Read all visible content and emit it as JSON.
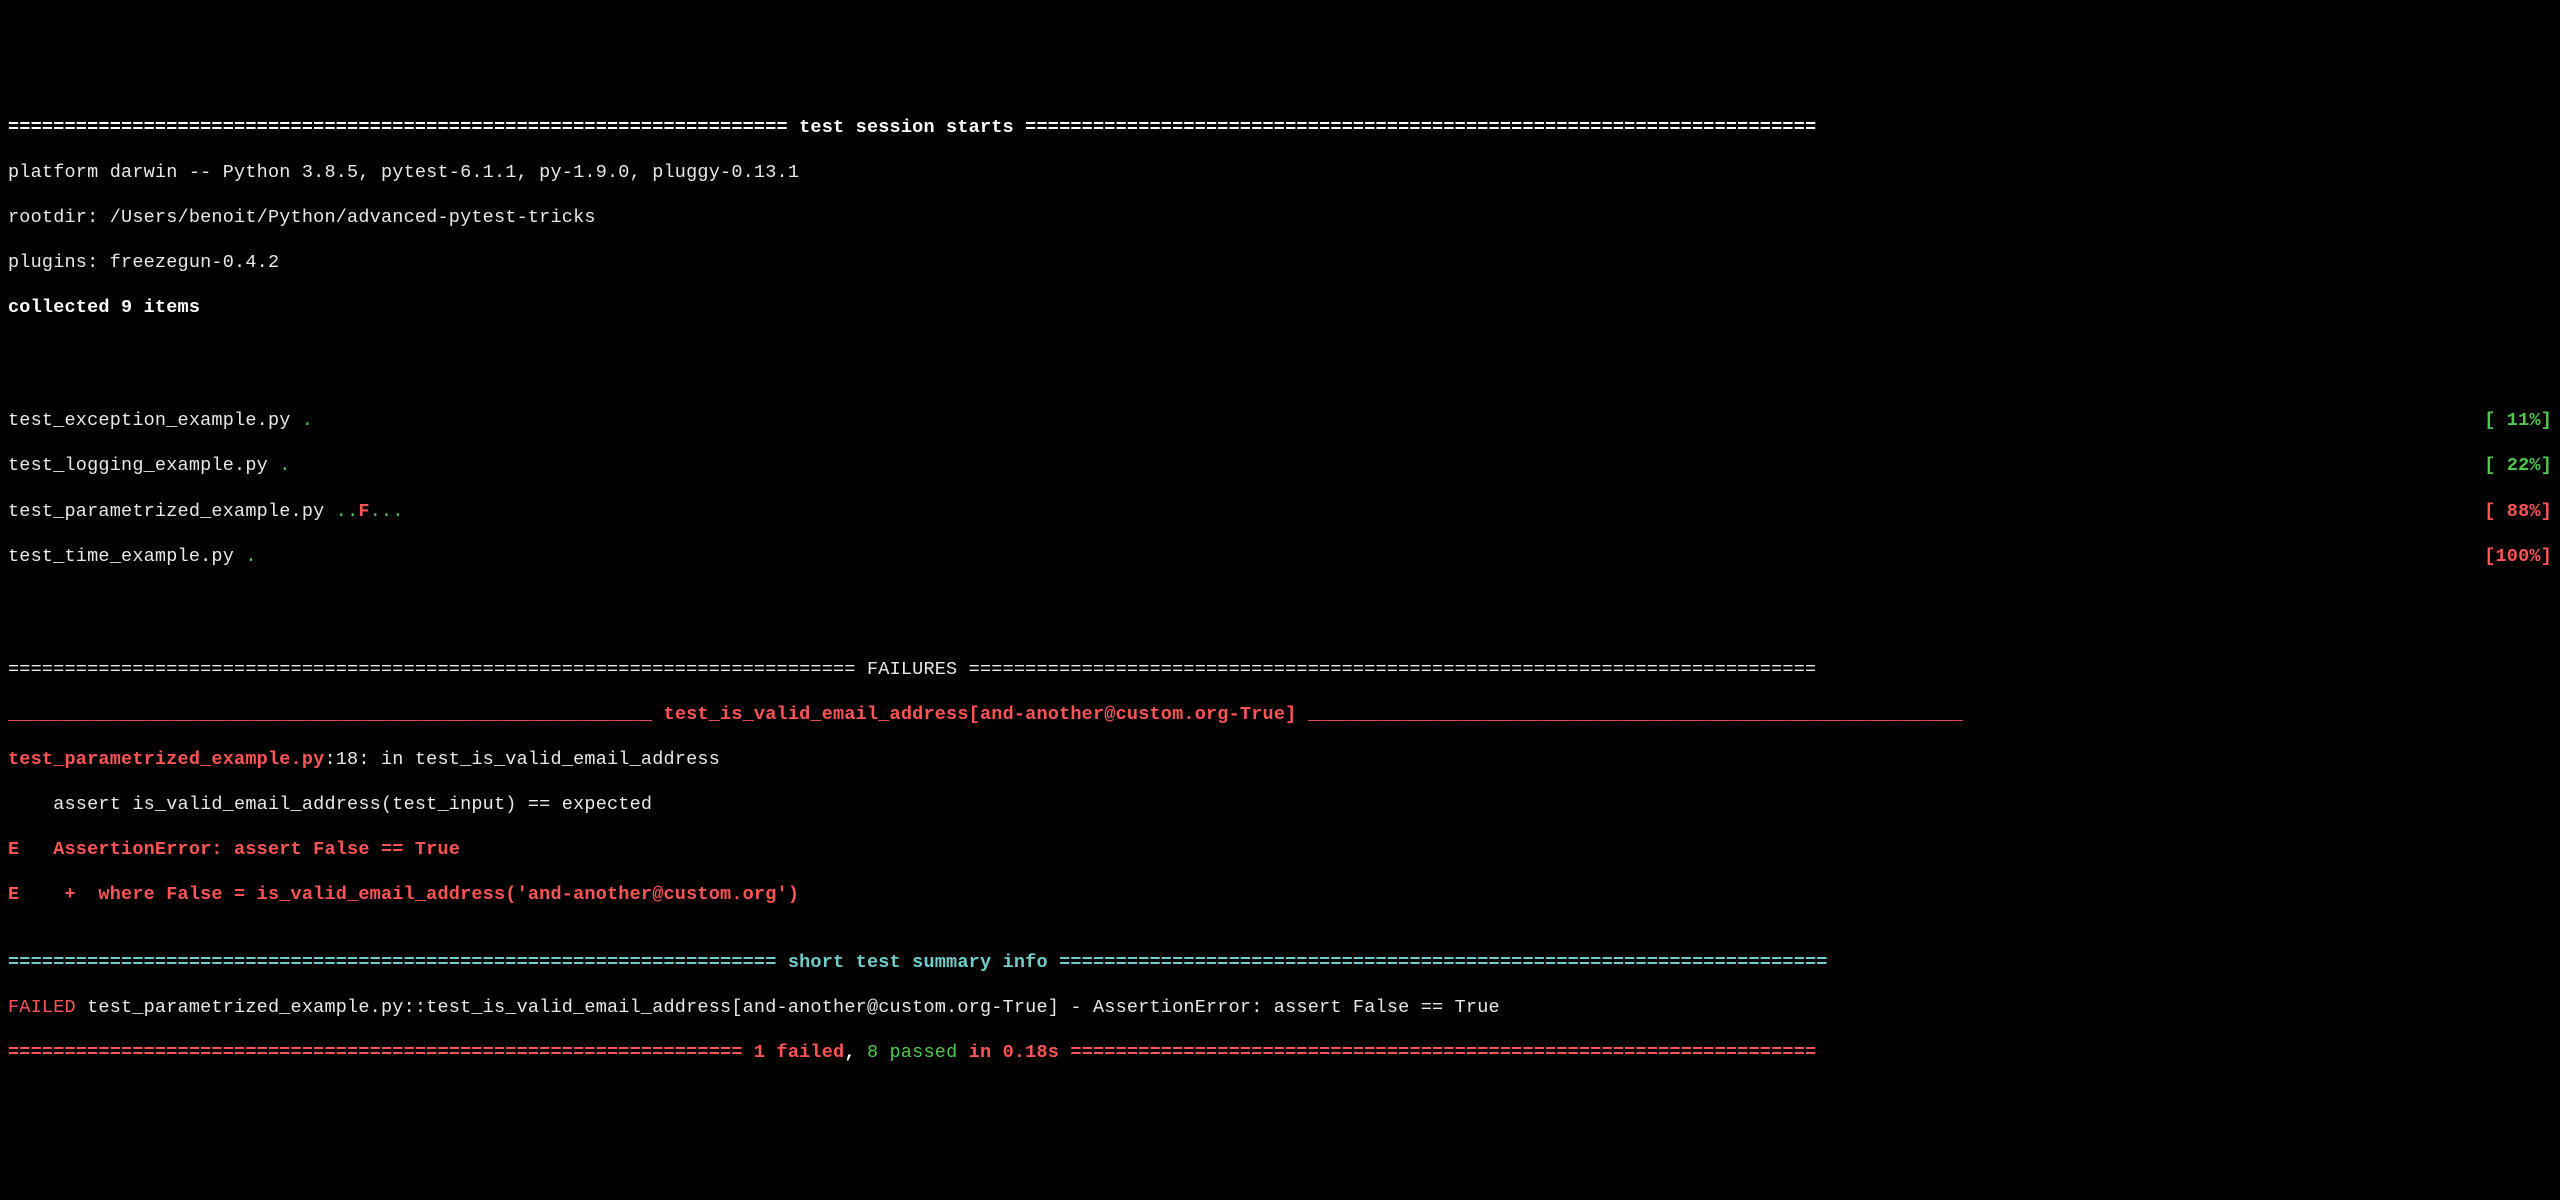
{
  "session": {
    "header_eq_left": "=====================================================================",
    "header_label": " test session starts ",
    "header_eq_right": "======================================================================",
    "platform_line": "platform darwin -- Python 3.8.5, pytest-6.1.1, py-1.9.0, pluggy-0.13.1",
    "rootdir_line": "rootdir: /Users/benoit/Python/advanced-pytest-tricks",
    "plugins_line": "plugins: freezegun-0.4.2",
    "collected_line": "collected 9 items"
  },
  "progress": [
    {
      "file": "test_exception_example.py ",
      "dots": ".",
      "pct": "[ 11%]",
      "pct_class": "bgreen",
      "dots_class": "green"
    },
    {
      "file": "test_logging_example.py ",
      "dots": ".",
      "pct": "[ 22%]",
      "pct_class": "bgreen",
      "dots_class": "green"
    },
    {
      "file": "test_parametrized_example.py ",
      "dots": "..F...",
      "pct": "[ 88%]",
      "pct_class": "bred",
      "dots_class": "mixed"
    },
    {
      "file": "test_time_example.py ",
      "dots": ".",
      "pct": "[100%]",
      "pct_class": "bred",
      "dots_class": "green"
    }
  ],
  "mixed_dots": {
    "leading": "..",
    "fail": "F",
    "trailing": "..."
  },
  "failures": {
    "header_eq_left": "=========================================================================== ",
    "header_label": "FAILURES",
    "header_eq_right": " ===========================================================================",
    "test_under_left": "_________________________________________________________ ",
    "test_name": "test_is_valid_email_address[and-another@custom.org-True]",
    "test_under_right": " __________________________________________________________",
    "loc_file": "test_parametrized_example.py",
    "loc_rest": ":18: in test_is_valid_email_address",
    "assert_line": "    assert is_valid_email_address(test_input) == expected",
    "err1": "E   AssertionError: assert False == True",
    "err2": "E    +  where False = is_valid_email_address('and-another@custom.org')"
  },
  "summary": {
    "short_eq_left": "==================================================================== ",
    "short_label": "short test summary info",
    "short_eq_right": " ====================================================================",
    "failed_line_prefix": "FAILED",
    "failed_line_rest": " test_parametrized_example.py::test_is_valid_email_address[and-another@custom.org-True] - AssertionError: assert False == True",
    "final_eq_left": "================================================================= ",
    "failed_count": "1 failed",
    "sep1": ", ",
    "passed_count": "8 passed",
    "in_time": " in 0.18s",
    "final_eq_right": " =================================================================="
  }
}
